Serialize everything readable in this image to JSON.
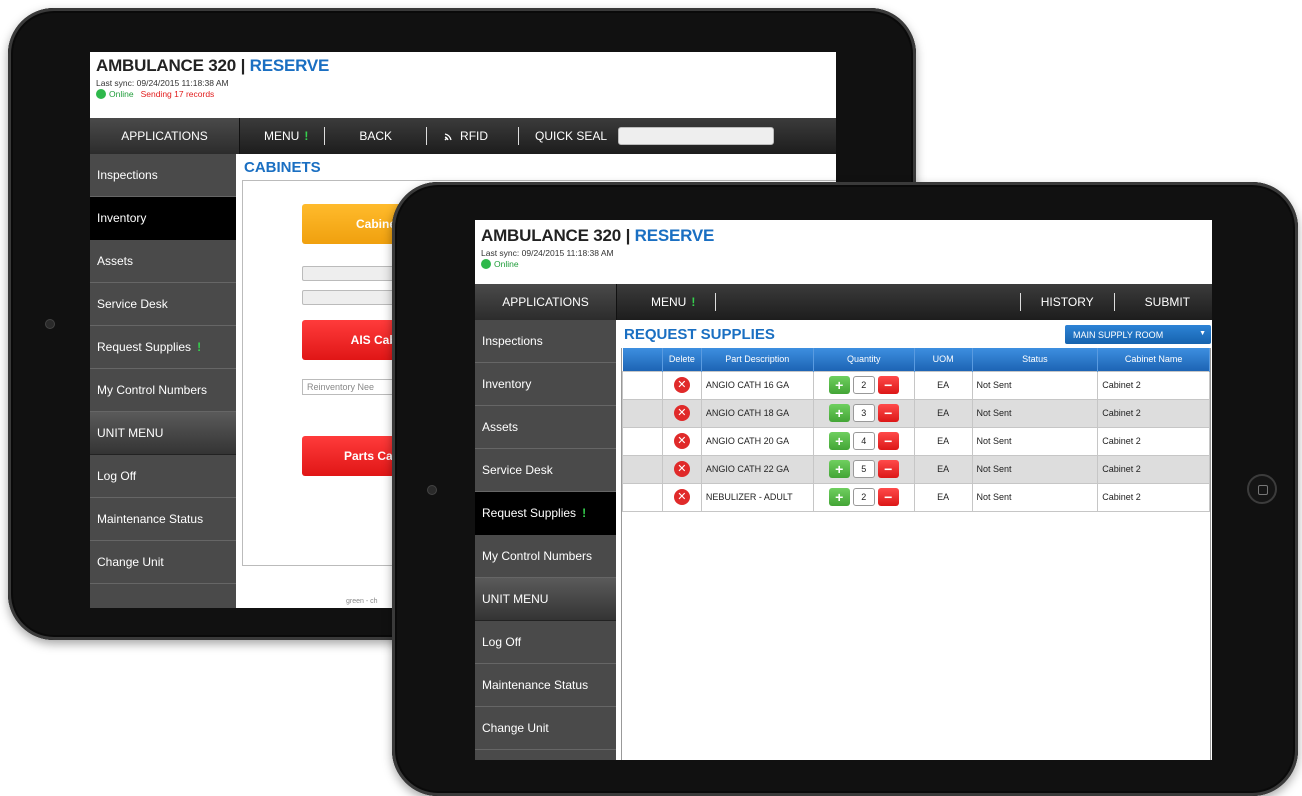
{
  "back": {
    "title_unit": "AMBULANCE 320",
    "title_sep": " | ",
    "title_status": "RESERVE",
    "sync": "Last sync: 09/24/2015 11:18:38 AM",
    "online": "Online",
    "sending": "Sending 17 records",
    "nav": {
      "applications": "APPLICATIONS",
      "menu": "MENU",
      "bang": "!",
      "back": "BACK",
      "rfid": "RFID",
      "quick_seal": "QUICK SEAL"
    },
    "sidebar": [
      {
        "label": "Inspections"
      },
      {
        "label": "Inventory"
      },
      {
        "label": "Assets"
      },
      {
        "label": "Service Desk"
      },
      {
        "label": "Request Supplies"
      },
      {
        "label": "My Control Numbers"
      }
    ],
    "unit_menu": "UNIT MENU",
    "unit_items": [
      {
        "label": "Log Off"
      },
      {
        "label": "Maintenance Status"
      },
      {
        "label": "Change Unit"
      }
    ],
    "section": "CABINETS",
    "cabinet_buttons": [
      "Cabinet",
      "AIS Cabi",
      "Parts Cab"
    ],
    "reinventory_note": "Reinventory Nee",
    "footer_fragment": "green - ch"
  },
  "front": {
    "title_unit": "AMBULANCE 320",
    "title_sep": " | ",
    "title_status": "RESERVE",
    "sync": "Last sync: 09/24/2015 11:18:38 AM",
    "online": "Online",
    "nav": {
      "applications": "APPLICATIONS",
      "menu": "MENU",
      "bang": "!",
      "history": "HISTORY",
      "submit": "SUBMIT"
    },
    "sidebar": [
      {
        "label": "Inspections"
      },
      {
        "label": "Inventory"
      },
      {
        "label": "Assets"
      },
      {
        "label": "Service Desk"
      },
      {
        "label": "Request Supplies"
      },
      {
        "label": "My Control Numbers"
      }
    ],
    "unit_menu": "UNIT MENU",
    "unit_items": [
      {
        "label": "Log Off"
      },
      {
        "label": "Maintenance Status"
      },
      {
        "label": "Change Unit"
      }
    ],
    "section": "REQUEST SUPPLIES",
    "supply_room": "MAIN SUPPLY ROOM",
    "columns": {
      "delete": "Delete",
      "part": "Part Description",
      "quantity": "Quantity",
      "uom": "UOM",
      "status": "Status",
      "cabinet": "Cabinet Name"
    },
    "rows": [
      {
        "part": "ANGIO CATH 16 GA",
        "qty": "2",
        "uom": "EA",
        "status": "Not Sent",
        "cabinet": "Cabinet 2"
      },
      {
        "part": "ANGIO CATH 18 GA",
        "qty": "3",
        "uom": "EA",
        "status": "Not Sent",
        "cabinet": "Cabinet 2"
      },
      {
        "part": "ANGIO CATH 20 GA",
        "qty": "4",
        "uom": "EA",
        "status": "Not Sent",
        "cabinet": "Cabinet 2"
      },
      {
        "part": "ANGIO CATH 22 GA",
        "qty": "5",
        "uom": "EA",
        "status": "Not Sent",
        "cabinet": "Cabinet 2"
      },
      {
        "part": "NEBULIZER - ADULT",
        "qty": "2",
        "uom": "EA",
        "status": "Not Sent",
        "cabinet": "Cabinet 2"
      }
    ]
  },
  "colors": {
    "accent_blue": "#1a6fc2",
    "online_green": "#2eb84b",
    "alert_red": "#e21d1d",
    "cabinet_orange": "#f0a00e"
  },
  "icons": {
    "delete": "x-circle-icon",
    "plus": "plus-icon",
    "minus": "minus-icon",
    "rfid": "rfid-signal-icon",
    "camera": "camera-icon",
    "home": "home-button-icon"
  }
}
